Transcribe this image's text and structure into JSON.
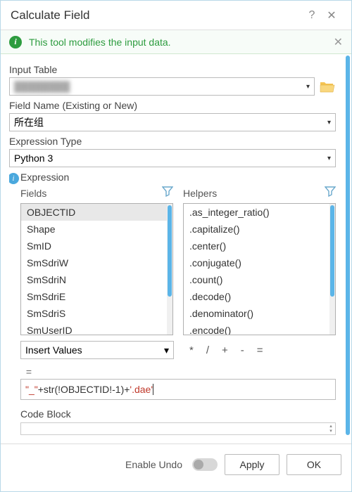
{
  "title": "Calculate Field",
  "info_banner": "This tool modifies the input data.",
  "input_table": {
    "label": "Input Table",
    "value": "████████"
  },
  "field_name": {
    "label": "Field Name (Existing or New)",
    "value": "所在组"
  },
  "expression_type": {
    "label": "Expression Type",
    "value": "Python 3"
  },
  "expression": {
    "label": "Expression",
    "fields_label": "Fields",
    "helpers_label": "Helpers",
    "fields": [
      "OBJECTID",
      "Shape",
      "SmID",
      "SmSdriW",
      "SmSdriN",
      "SmSdriE",
      "SmSdriS",
      "SmUserID"
    ],
    "fields_selected": "OBJECTID",
    "helpers": [
      ".as_integer_ratio()",
      ".capitalize()",
      ".center()",
      ".conjugate()",
      ".count()",
      ".decode()",
      ".denominator()",
      ".encode()"
    ],
    "insert_values_label": "Insert Values",
    "operators": [
      "*",
      "/",
      "+",
      "-",
      "="
    ],
    "eq": "=",
    "expr_parts": {
      "s1": "\"_\"",
      "t1": "+str(!OBJECTID!-1)+",
      "s2": "'.dae'"
    }
  },
  "code_block_label": "Code Block",
  "bottom": {
    "enable_undo": "Enable Undo",
    "apply": "Apply",
    "ok": "OK"
  }
}
